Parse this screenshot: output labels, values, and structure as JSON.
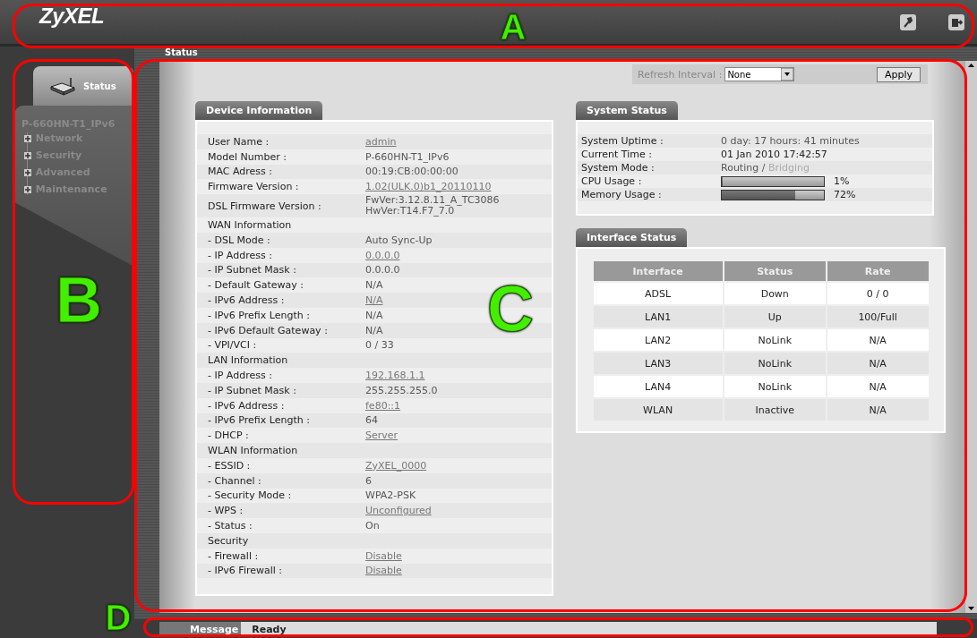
{
  "header": {
    "logo": "ZyXEL"
  },
  "sidebar": {
    "tab": {
      "label": "Status",
      "selected": true
    },
    "device": "P-660HN-T1_IPv6",
    "items": [
      {
        "label": "Network",
        "expanded": false
      },
      {
        "label": "Security",
        "expanded": false
      },
      {
        "label": "Advanced",
        "expanded": false
      },
      {
        "label": "Maintenance",
        "expanded": false
      }
    ]
  },
  "breadcrumb": "Status",
  "refresh": {
    "label": "Refresh Interval :",
    "value": "None",
    "button": "Apply"
  },
  "device_info": {
    "title": "Device Information",
    "rows": [
      {
        "kind": "field",
        "label": "User Name :",
        "value": "admin",
        "link": true
      },
      {
        "kind": "field",
        "label": "Model Number :",
        "value": "P-660HN-T1_IPv6",
        "link": false
      },
      {
        "kind": "field",
        "label": "MAC Adress :",
        "value": "00:19:CB:00:00:00",
        "link": false
      },
      {
        "kind": "field",
        "label": "Firmware Version :",
        "value": "1.02(ULK.0)b1_20110110",
        "link": true
      },
      {
        "kind": "field",
        "label": "DSL Firmware Version :",
        "value": "FwVer:3.12.8.11_A_TC3086",
        "value2": "HwVer:T14.F7_7.0",
        "link": false
      },
      {
        "kind": "section",
        "label": "WAN Information"
      },
      {
        "kind": "field",
        "label": "- DSL Mode :",
        "value": "Auto Sync-Up",
        "link": false
      },
      {
        "kind": "field",
        "label": "- IP Address :",
        "value": "0.0.0.0",
        "link": true
      },
      {
        "kind": "field",
        "label": "- IP Subnet Mask :",
        "value": "0.0.0.0",
        "link": false
      },
      {
        "kind": "field",
        "label": "- Default Gateway :",
        "value": "N/A",
        "link": false
      },
      {
        "kind": "field",
        "label": "- IPv6 Address :",
        "value": "N/A",
        "link": true
      },
      {
        "kind": "field",
        "label": "- IPv6 Prefix Length :",
        "value": "N/A",
        "link": false
      },
      {
        "kind": "field",
        "label": "- IPv6 Default Gateway :",
        "value": "N/A",
        "link": false
      },
      {
        "kind": "field",
        "label": "- VPI/VCI :",
        "value": "0 / 33",
        "link": false
      },
      {
        "kind": "section",
        "label": "LAN Information"
      },
      {
        "kind": "field",
        "label": "- IP Address :",
        "value": "192.168.1.1",
        "link": true
      },
      {
        "kind": "field",
        "label": "- IP Subnet Mask :",
        "value": "255.255.255.0",
        "link": false
      },
      {
        "kind": "field",
        "label": "- IPv6 Address :",
        "value": "fe80::1",
        "link": true
      },
      {
        "kind": "field",
        "label": "- IPv6 Prefix Length :",
        "value": "64",
        "link": false
      },
      {
        "kind": "field",
        "label": "- DHCP :",
        "value": "Server",
        "link": true
      },
      {
        "kind": "section",
        "label": "WLAN Information"
      },
      {
        "kind": "field",
        "label": "- ESSID :",
        "value": "ZyXEL_0000",
        "link": true
      },
      {
        "kind": "field",
        "label": "- Channel :",
        "value": "6",
        "link": false
      },
      {
        "kind": "field",
        "label": "- Security Mode :",
        "value": "WPA2-PSK",
        "link": false
      },
      {
        "kind": "field",
        "label": "- WPS :",
        "value": "Unconfigured",
        "link": true
      },
      {
        "kind": "field",
        "label": "- Status :",
        "value": "On",
        "link": false
      },
      {
        "kind": "section",
        "label": "Security"
      },
      {
        "kind": "field",
        "label": "- Firewall :",
        "value": "Disable",
        "link": true
      },
      {
        "kind": "field",
        "label": "- IPv6 Firewall :",
        "value": "Disable",
        "link": true
      }
    ]
  },
  "system_status": {
    "title": "System Status",
    "rows": [
      {
        "kind": "text",
        "label": "System Uptime :",
        "value": "0 day: 17 hours: 41 minutes"
      },
      {
        "kind": "text",
        "label": "Current Time :",
        "value": "01 Jan 2010 17:42:57"
      },
      {
        "kind": "mode",
        "label": "System Mode :",
        "options": [
          {
            "label": "Routing",
            "selected": true
          },
          {
            "label": "Bridging",
            "selected": false
          }
        ],
        "separator": "/"
      },
      {
        "kind": "meter",
        "label": "CPU Usage :",
        "level": 0.01,
        "reading": "1%"
      },
      {
        "kind": "meter",
        "label": "Memory Usage :",
        "level": 0.72,
        "reading": "72%"
      }
    ]
  },
  "interface_status": {
    "title": "Interface Status",
    "columns": [
      "Interface",
      "Status",
      "Rate"
    ],
    "rows": [
      [
        "ADSL",
        "Down",
        "0 / 0"
      ],
      [
        "LAN1",
        "Up",
        "100/Full"
      ],
      [
        "LAN2",
        "NoLink",
        "N/A"
      ],
      [
        "LAN3",
        "NoLink",
        "N/A"
      ],
      [
        "LAN4",
        "NoLink",
        "N/A"
      ],
      [
        "WLAN",
        "Inactive",
        "N/A"
      ]
    ]
  },
  "status_bar": {
    "label": "Message",
    "value": "Ready"
  },
  "callouts": [
    {
      "label": "A"
    },
    {
      "label": "B"
    },
    {
      "label": "C"
    },
    {
      "label": "D"
    }
  ]
}
